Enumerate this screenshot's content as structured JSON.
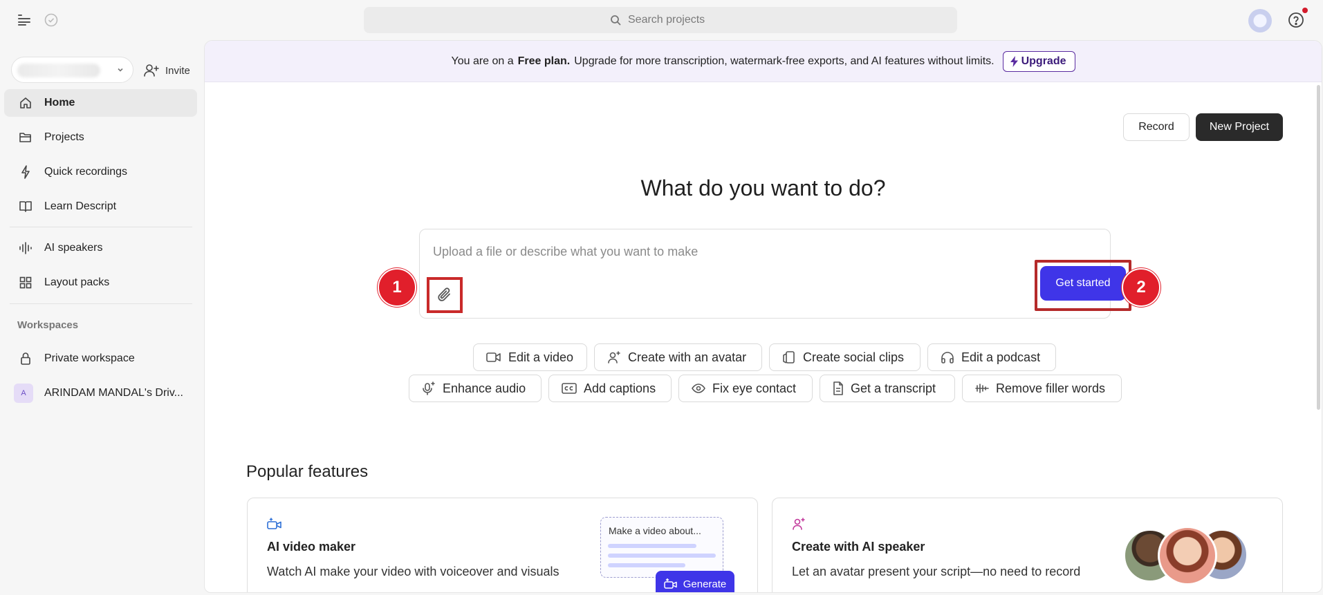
{
  "search": {
    "placeholder": "Search projects"
  },
  "sidebar": {
    "invite_label": "Invite",
    "nav": [
      {
        "label": "Home",
        "icon": "home-icon",
        "active": true
      },
      {
        "label": "Projects",
        "icon": "folder-icon"
      },
      {
        "label": "Quick recordings",
        "icon": "lightning-icon"
      },
      {
        "label": "Learn Descript",
        "icon": "book-icon"
      },
      {
        "label": "AI speakers",
        "icon": "waveform-icon"
      },
      {
        "label": "Layout packs",
        "icon": "grid-icon"
      }
    ],
    "workspaces_label": "Workspaces",
    "workspaces": [
      {
        "label": "Private workspace",
        "icon": "lock-icon"
      },
      {
        "label": "ARINDAM MANDAL's Driv...",
        "badge": "A"
      }
    ]
  },
  "banner": {
    "prefix": "You are on a",
    "plan": "Free plan.",
    "suffix": "Upgrade for more transcription, watermark-free exports, and AI features without limits.",
    "upgrade_label": "Upgrade"
  },
  "actions": {
    "record_label": "Record",
    "new_project_label": "New Project"
  },
  "headline": "What do you want to do?",
  "prompt": {
    "placeholder": "Upload a file or describe what you want to make",
    "get_started_label": "Get started"
  },
  "markers": [
    "1",
    "2"
  ],
  "chips_row1": [
    {
      "label": "Edit a video",
      "icon": "video-camera-icon"
    },
    {
      "label": "Create with an avatar",
      "icon": "avatar-sparkle-icon"
    },
    {
      "label": "Create social clips",
      "icon": "social-clips-icon"
    },
    {
      "label": "Edit a podcast",
      "icon": "headphones-icon"
    }
  ],
  "chips_row2": [
    {
      "label": "Enhance audio",
      "icon": "mic-sparkle-icon"
    },
    {
      "label": "Add captions",
      "icon": "cc-icon"
    },
    {
      "label": "Fix eye contact",
      "icon": "eye-icon"
    },
    {
      "label": "Get a transcript",
      "icon": "document-icon"
    },
    {
      "label": "Remove filler words",
      "icon": "filler-words-icon"
    }
  ],
  "popular": {
    "title": "Popular features",
    "cards": [
      {
        "title": "AI video maker",
        "desc": "Watch AI make your video with voiceover and visuals",
        "mock_text": "Make a video about...",
        "generate_label": "Generate"
      },
      {
        "title": "Create with AI speaker",
        "desc": "Let an avatar present your script—no need to record"
      }
    ]
  },
  "colors": {
    "accent": "#3f35e8",
    "annotation_red": "#e11f2b",
    "banner_bg": "#f3f0fb",
    "upgrade": "#5a2ba0"
  }
}
